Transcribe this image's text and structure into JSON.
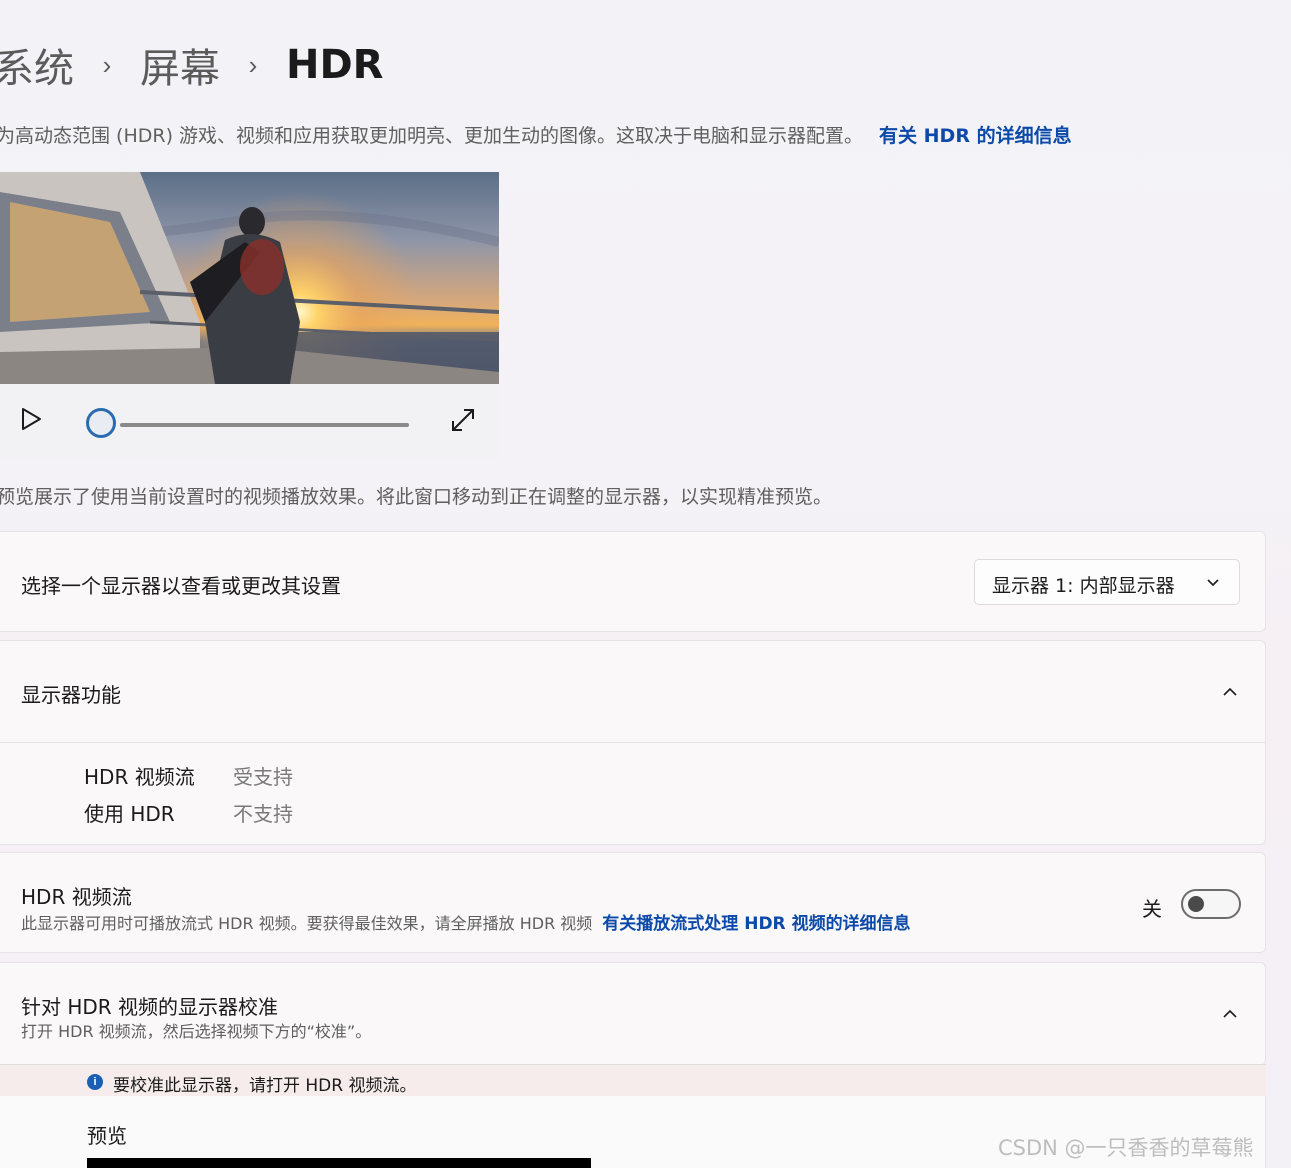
{
  "breadcrumb": {
    "items": [
      "系统",
      "屏幕",
      "HDR"
    ],
    "separator": "›"
  },
  "description": {
    "text": "为高动态范围 (HDR) 游戏、视频和应用获取更加明亮、更加生动的图像。这取决于电脑和显示器配置。",
    "link": "有关 HDR 的详细信息"
  },
  "video_player": {
    "progress": 0
  },
  "preview_note": "预览展示了使用当前设置时的视频播放效果。将此窗口移动到正在调整的显示器，以实现精准预览。",
  "display_select": {
    "label": "选择一个显示器以查看或更改其设置",
    "value": "显示器 1: 内部显示器"
  },
  "capabilities": {
    "title": "显示器功能",
    "rows": [
      {
        "name": "HDR 视频流",
        "value": "受支持"
      },
      {
        "name": "使用 HDR",
        "value": "不支持"
      }
    ]
  },
  "hdr_stream": {
    "title": "HDR 视频流",
    "subtitle": "此显示器可用时可播放流式 HDR 视频。要获得最佳效果，请全屏播放 HDR 视频",
    "link": "有关播放流式处理 HDR 视频的详细信息",
    "toggle_label": "关",
    "toggle_on": false
  },
  "calibration": {
    "title": "针对 HDR 视频的显示器校准",
    "subtitle": "打开 HDR 视频流，然后选择视频下方的“校准”。",
    "info": "要校准此显示器，请打开 HDR 视频流。",
    "preview_label": "预览"
  },
  "watermark": "CSDN @一只香香的草莓熊"
}
